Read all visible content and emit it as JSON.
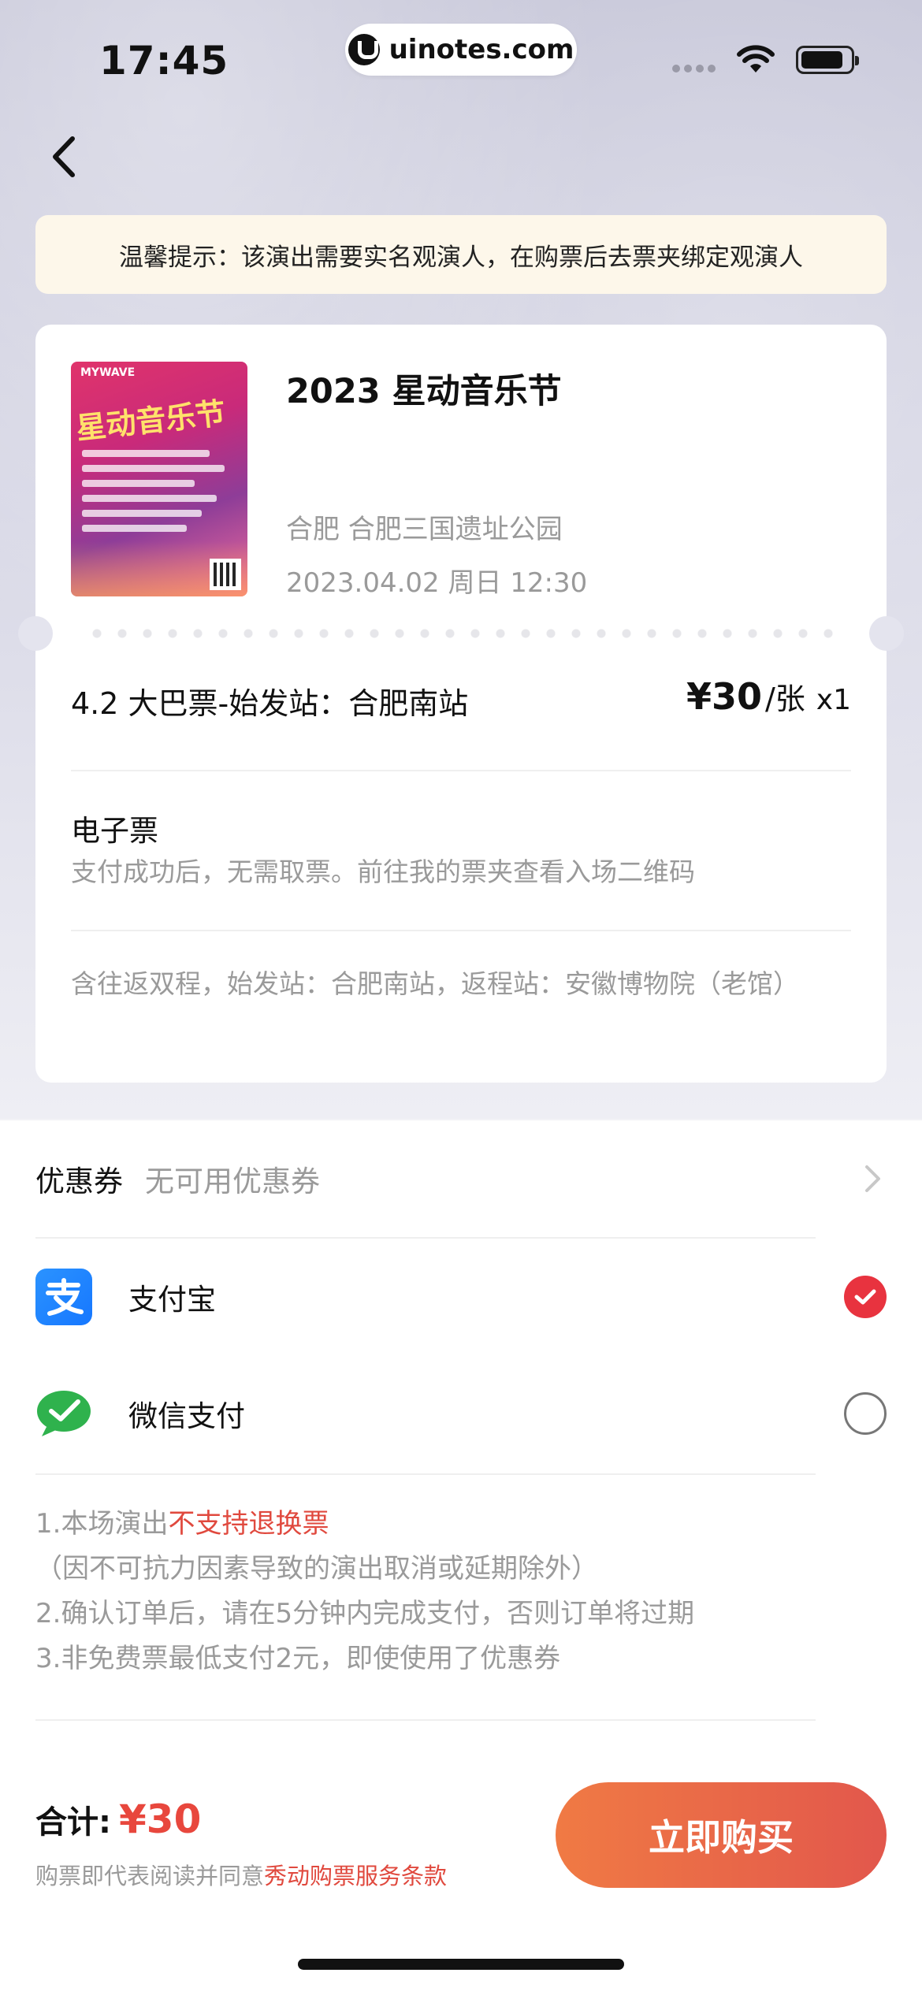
{
  "status_bar": {
    "time": "17:45",
    "url": "uinotes.com"
  },
  "notice": {
    "text": "温馨提示：该演出需要实名观演人，在购票后去票夹绑定观演人"
  },
  "event": {
    "title": "2023 星动音乐节",
    "venue": "合肥 合肥三国遗址公园",
    "datetime": "2023.04.02 周日 12:30",
    "poster": {
      "brand": "MYWAVE",
      "title": "星动音乐节"
    }
  },
  "ticket": {
    "name": "4.2 大巴票-始发站：合肥南站",
    "price": "¥30",
    "unit": "/张",
    "quantity": "x1",
    "type_title": "电子票",
    "type_desc": "支付成功后，无需取票。前往我的票夹查看入场二维码",
    "route_note": "含往返双程，始发站：合肥南站，返程站：安徽博物院（老馆）"
  },
  "coupon": {
    "label": "优惠券",
    "value": "无可用优惠券"
  },
  "payment_methods": [
    {
      "label": "支付宝",
      "icon": "alipay-icon",
      "selected": true
    },
    {
      "label": "微信支付",
      "icon": "wechat-pay-icon",
      "selected": false
    }
  ],
  "notes": {
    "line1_prefix": "1.本场演出",
    "line1_highlight": "不支持退换票",
    "line1_suffix": "（因不可抗力因素导致的演出取消或延期除外）",
    "line2": "2.确认订单后，请在5分钟内完成支付，否则订单将过期",
    "line3": "3.非免费票最低支付2元，即使使用了优惠券"
  },
  "footer": {
    "total_label": "合计:",
    "total_amount": "¥30",
    "agreement_prefix": "购票即代表阅读并同意",
    "agreement_link": "秀动购票服务条款",
    "buy_label": "立即购买"
  },
  "colors": {
    "accent_red": "#e8333f",
    "price_red": "#e8473d",
    "button_gradient_start": "#f07a44",
    "button_gradient_end": "#e2574c",
    "notice_bg": "#fdf7ea"
  }
}
